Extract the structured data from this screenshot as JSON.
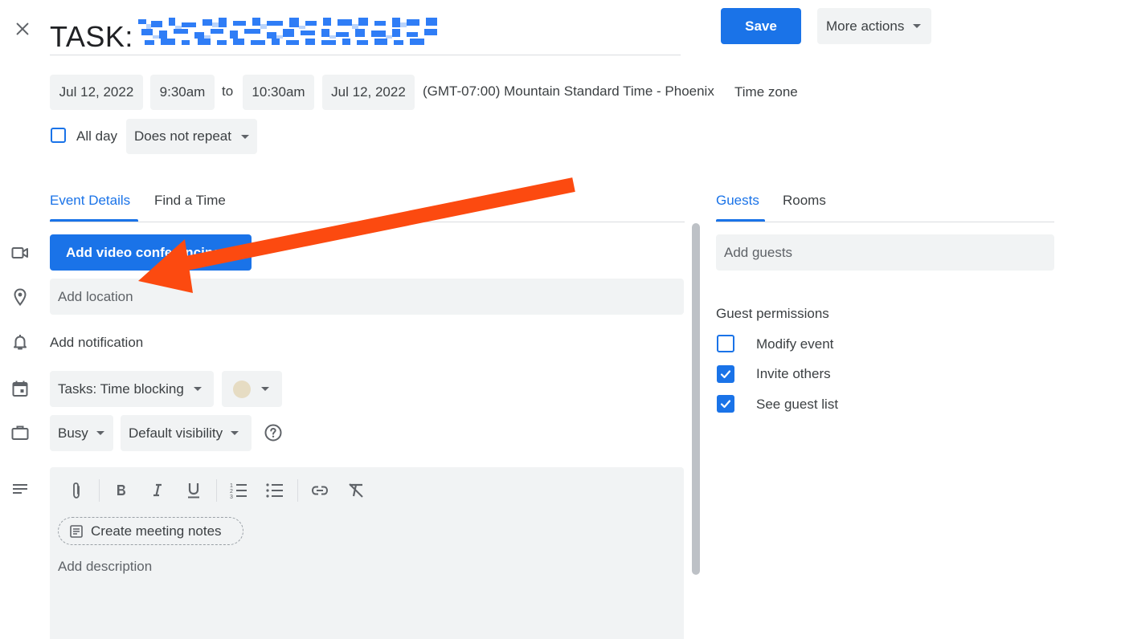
{
  "header": {
    "title_prefix": "TASK:",
    "save_label": "Save",
    "more_actions_label": "More actions"
  },
  "datetime": {
    "start_date": "Jul 12, 2022",
    "start_time": "9:30am",
    "separator": "to",
    "end_time": "10:30am",
    "end_date": "Jul 12, 2022",
    "timezone_text": "(GMT-07:00) Mountain Standard Time - Phoenix",
    "timezone_button": "Time zone",
    "all_day_label": "All day",
    "all_day_checked": false,
    "repeat_value": "Does not repeat"
  },
  "tabs": {
    "left": [
      {
        "label": "Event Details",
        "active": true
      },
      {
        "label": "Find a Time",
        "active": false
      }
    ],
    "right": [
      {
        "label": "Guests",
        "active": true
      },
      {
        "label": "Rooms",
        "active": false
      }
    ]
  },
  "details": {
    "video_button": "Add video conferencing",
    "location_placeholder": "Add location",
    "notification_label": "Add notification",
    "calendar_value": "Tasks: Time blocking",
    "color_value": "#e6dcc3",
    "availability_value": "Busy",
    "visibility_value": "Default visibility",
    "create_notes_label": "Create meeting notes",
    "description_placeholder": "Add description"
  },
  "guests": {
    "input_placeholder": "Add guests",
    "permissions_title": "Guest permissions",
    "permissions": [
      {
        "label": "Modify event",
        "checked": false
      },
      {
        "label": "Invite others",
        "checked": true
      },
      {
        "label": "See guest list",
        "checked": true
      }
    ]
  },
  "toolbar_icons": [
    "attach-icon",
    "bold-icon",
    "italic-icon",
    "underline-icon",
    "numbered-list-icon",
    "bulleted-list-icon",
    "link-icon",
    "clear-formatting-icon"
  ],
  "colors": {
    "accent": "#1a73e8",
    "field_bg": "#f1f3f4",
    "annotation_arrow": "#fc4a10"
  }
}
